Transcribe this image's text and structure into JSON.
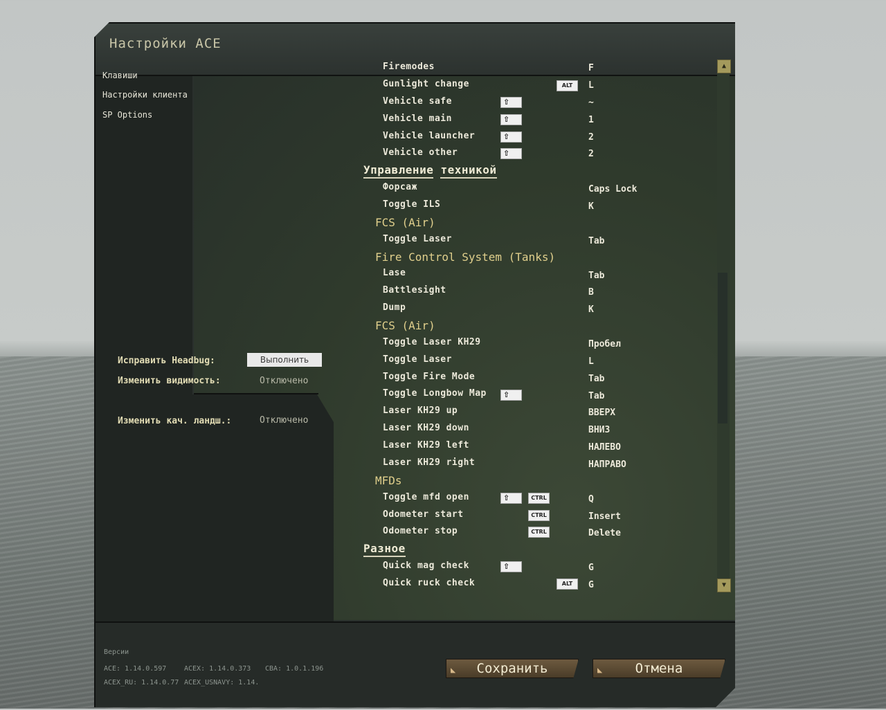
{
  "window": {
    "title": "Настройки ACE"
  },
  "nav": {
    "items": [
      "Клавиши",
      "Настройки клиента",
      "SP Options"
    ]
  },
  "options": {
    "headbug_label": "Исправить Headbug:",
    "headbug_button": "Выполнить",
    "visibility_label": "Изменить видимость:",
    "visibility_value": "Отключено",
    "terrain_label": "Изменить кач. ландш.:",
    "terrain_value": "Отключено"
  },
  "keys": {
    "firemodes": {
      "name": "Firemodes",
      "key": "F"
    },
    "gunlight": {
      "name": "Gunlight change",
      "mod": "ALT",
      "key": "L"
    },
    "vehicle_safe": {
      "name": "Vehicle safe",
      "mod": "⇧",
      "key": "~"
    },
    "vehicle_main": {
      "name": "Vehicle main",
      "mod": "⇧",
      "key": "1"
    },
    "vehicle_launcher": {
      "name": "Vehicle launcher",
      "mod": "⇧",
      "key": "2"
    },
    "vehicle_other": {
      "name": "Vehicle other",
      "mod": "⇧",
      "key": "2"
    },
    "section_vehicle": [
      "Управление",
      "техникой"
    ],
    "forsazh": {
      "name": "Форсаж",
      "key": "Caps Lock"
    },
    "toggle_ils": {
      "name": "Toggle ILS",
      "key": "K"
    },
    "fcs_air1": "FCS (Air)",
    "toggle_laser1": {
      "name": "Toggle Laser",
      "key": "Tab"
    },
    "fcs_tanks": "Fire Control System (Tanks)",
    "lase": {
      "name": "Lase",
      "key": "Tab"
    },
    "battlesight": {
      "name": "Battlesight",
      "key": "B"
    },
    "dump": {
      "name": "Dump",
      "key": "K"
    },
    "fcs_air2": "FCS (Air)",
    "toggle_laser_kh29": {
      "name": "Toggle Laser KH29",
      "key": "Пробел"
    },
    "toggle_laser2": {
      "name": "Toggle Laser",
      "key": "L"
    },
    "toggle_fire_mode": {
      "name": "Toggle Fire Mode",
      "key": "Tab"
    },
    "toggle_longbow": {
      "name": "Toggle Longbow Map",
      "mod": "⇧",
      "key": "Tab"
    },
    "laser_up": {
      "name": "Laser KH29 up",
      "key": "ВВЕРХ"
    },
    "laser_down": {
      "name": "Laser KH29 down",
      "key": "ВНИЗ"
    },
    "laser_left": {
      "name": "Laser KH29 left",
      "key": "НАЛЕВО"
    },
    "laser_right": {
      "name": "Laser KH29 right",
      "key": "НАПРАВО"
    },
    "mfds": "MFDs",
    "toggle_mfd": {
      "name": "Toggle mfd open",
      "mod1": "⇧",
      "mod2": "CTRL",
      "key": "Q"
    },
    "odometer_start": {
      "name": "Odometer start",
      "mod": "CTRL",
      "key": "Insert"
    },
    "odometer_stop": {
      "name": "Odometer stop",
      "mod": "CTRL",
      "key": "Delete"
    },
    "section_misc": "Разное",
    "quick_mag": {
      "name": "Quick mag check",
      "mod": "⇧",
      "key": "G"
    },
    "quick_ruck": {
      "name": "Quick ruck check",
      "mod": "ALT",
      "key": "G"
    }
  },
  "versions": {
    "label": "Версии",
    "ace": "ACE: 1.14.0.597",
    "acex": "ACEX: 1.14.0.373",
    "cba": "CBA: 1.0.1.196",
    "acex_ru": "ACEX_RU: 1.14.0.77",
    "acex_usnavy": "ACEX_USNAVY: 1.14."
  },
  "buttons": {
    "save": "Сохранить",
    "cancel": "Отмена"
  }
}
